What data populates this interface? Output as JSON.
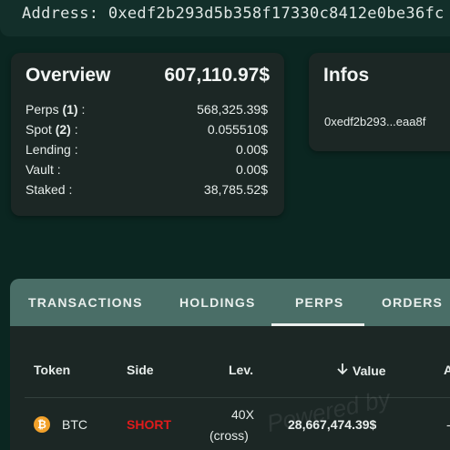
{
  "address_bar": {
    "label": "Address:",
    "value": "0xedf2b293d5b358f17330c8412e0be36fc"
  },
  "overview": {
    "title": "Overview",
    "total": "607,110.97$",
    "rows": [
      {
        "label": "Perps",
        "count": "(1)",
        "suffix": " :",
        "value": "568,325.39$"
      },
      {
        "label": "Spot",
        "count": "(2)",
        "suffix": " :",
        "value": "0.055510$"
      },
      {
        "label": "Lending :",
        "count": "",
        "suffix": "",
        "value": "0.00$"
      },
      {
        "label": "Vault :",
        "count": "",
        "suffix": "",
        "value": "0.00$"
      },
      {
        "label": "Staked :",
        "count": "",
        "suffix": "",
        "value": "38,785.52$"
      }
    ]
  },
  "infos": {
    "title": "Infos",
    "address_short": "0xedf2b293...eaa8f"
  },
  "tabs": [
    {
      "label": "TRANSACTIONS",
      "active": false
    },
    {
      "label": "HOLDINGS",
      "active": false
    },
    {
      "label": "PERPS",
      "active": true
    },
    {
      "label": "ORDERS",
      "active": false
    }
  ],
  "table": {
    "headers": {
      "token": "Token",
      "side": "Side",
      "lev": "Lev.",
      "value": "Value",
      "next": "A"
    },
    "rows": [
      {
        "token": "BTC",
        "token_icon": "bitcoin-icon",
        "side": "SHORT",
        "lev_line1": "40X",
        "lev_line2": "(cross)",
        "value": "28,667,474.39$",
        "next": "-"
      }
    ]
  },
  "watermark": "Powered by",
  "colors": {
    "background": "#0b2621",
    "card": "#1c2725",
    "tab_bar": "#4a6e67",
    "short": "#e01b1b",
    "btc": "#f2a12a"
  }
}
